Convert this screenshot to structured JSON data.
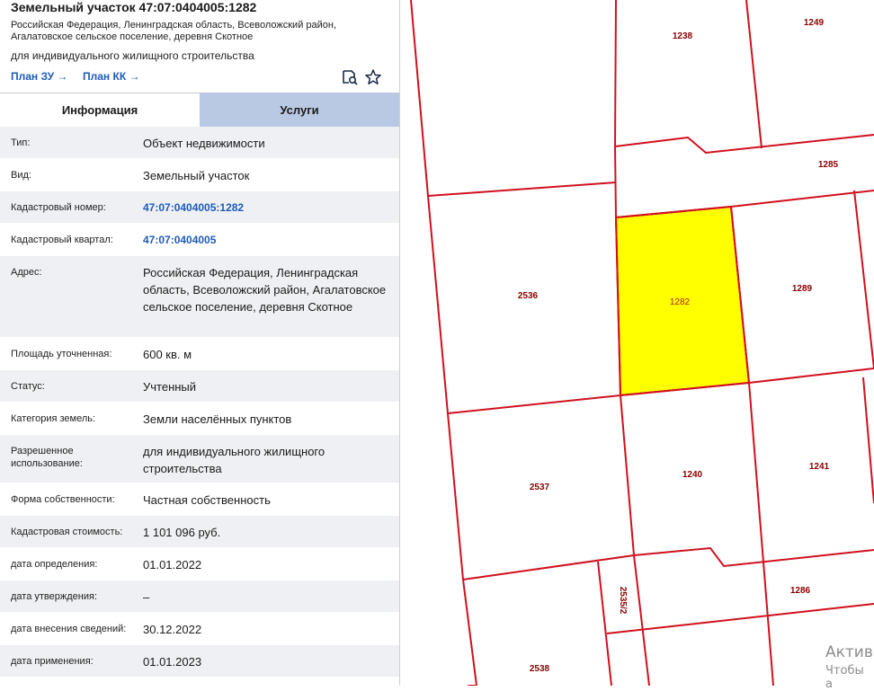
{
  "panel": {
    "title": "Земельный участок 47:07:0404005:1282",
    "address_short_line1": "Российская Федерация, Ленинградская область, Всеволожский район,",
    "address_short_line2": "Агалатовское сельское поселение, деревня Скотное",
    "purpose": "для индивидуального жилищного строительства",
    "plan_zu": "План ЗУ →",
    "plan_kk": "План КК →",
    "tabs": [
      "Информация",
      "Услуги"
    ],
    "rows": [
      {
        "label": "Тип:",
        "value": "Объект недвижимости"
      },
      {
        "label": "Вид:",
        "value": "Земельный участок"
      },
      {
        "label": "Кадастровый номер:",
        "value": "47:07:0404005:1282"
      },
      {
        "label": "Кадастровый квартал:",
        "value": "47:07:0404005"
      },
      {
        "label": "Адрес:",
        "value": "Российская Федерация, Ленинградская область, Всеволожский район, Агалатовское сельское поселение, деревня Скотное"
      },
      {
        "label": "Площадь уточненная:",
        "value": "600 кв. м"
      },
      {
        "label": "Статус:",
        "value": "Учтенный"
      },
      {
        "label": "Категория земель:",
        "value": "Земли населённых пунктов"
      },
      {
        "label": "Разрешенное использование:",
        "value": "для индивидуального жилищного строительства"
      },
      {
        "label": "Форма собственности:",
        "value": "Частная собственность"
      },
      {
        "label": "Кадастровая стоимость:",
        "value": "1 101 096 руб."
      },
      {
        "label": "дата определения:",
        "value": "01.01.2022"
      },
      {
        "label": "дата утверждения:",
        "value": "–"
      },
      {
        "label": "дата внесения сведений:",
        "value": "30.12.2022"
      },
      {
        "label": "дата применения:",
        "value": "01.01.2023"
      }
    ]
  },
  "map": {
    "parcel_labels": [
      "1238",
      "1249",
      "1285",
      "2536",
      "1282",
      "1289",
      "2537",
      "1240",
      "1241",
      "2535/2",
      "1286",
      "2538"
    ],
    "watermark_line1": "Актив",
    "watermark_line2": "Чтобы а",
    "colors": {
      "boundary": "#d0101e",
      "selected_fill": "#ffff00",
      "label": "#8b0000"
    }
  }
}
